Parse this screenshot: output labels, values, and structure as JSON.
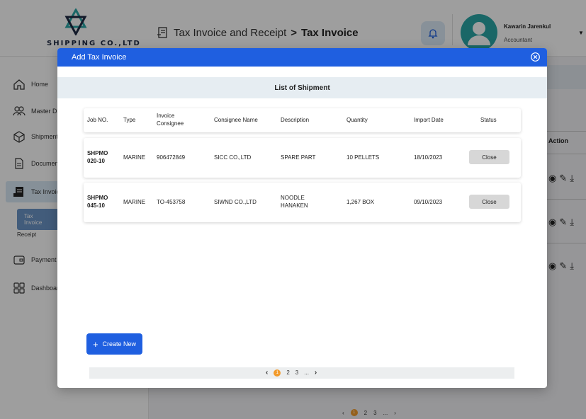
{
  "header": {
    "logo_text": "SHIPPING CO.,LTD",
    "breadcrumb_parent": "Tax Invoice and Receipt",
    "breadcrumb_sep": ">",
    "breadcrumb_current": "Tax Invoice",
    "user_name": "Kawarin Jarenkul",
    "user_role": "Accountant"
  },
  "sidebar": {
    "items": [
      {
        "label": "Home",
        "icon": "home-icon"
      },
      {
        "label": "Master Data",
        "icon": "users-icon"
      },
      {
        "label": "Shipment",
        "icon": "box-icon"
      },
      {
        "label": "Document",
        "icon": "document-icon"
      },
      {
        "label": "Tax Invoice",
        "icon": "invoice-icon"
      },
      {
        "label": "Payment",
        "icon": "wallet-icon"
      },
      {
        "label": "Dashboard",
        "icon": "dashboard-icon"
      }
    ],
    "sub_items": [
      "Tax Invoice",
      "Receipt"
    ]
  },
  "background": {
    "action_header": "Action",
    "pager": [
      "1",
      "2",
      "3",
      "..."
    ]
  },
  "modal": {
    "title": "Add Tax Invoice",
    "list_title": "List of Shipment",
    "columns": [
      "Job NO.",
      "Type",
      "Invoice Consignee",
      "Consignee Name",
      "Description",
      "Quantity",
      "Import Date",
      "Status"
    ],
    "rows": [
      {
        "job_no": "SHPMO 020-10",
        "type": "MARINE",
        "invoice_consignee": "906472849",
        "consignee_name": "SICC CO.,LTD",
        "description": "SPARE PART",
        "quantity": "10 PELLETS",
        "import_date": "18/10/2023",
        "status": "Close"
      },
      {
        "job_no": "SHPMO 045-10",
        "type": "MARINE",
        "invoice_consignee": "TO-453758",
        "consignee_name": "SIWND CO.,LTD",
        "description": "NOODLE HANAKEN",
        "quantity": "1,267 BOX",
        "import_date": "09/10/2023",
        "status": "Close"
      }
    ],
    "create_label": "Create New",
    "pager": [
      "1",
      "2",
      "3",
      "..."
    ]
  },
  "colors": {
    "primary": "#1f5fe0",
    "accent": "#f29b2c",
    "avatar": "#2aa7a7"
  }
}
